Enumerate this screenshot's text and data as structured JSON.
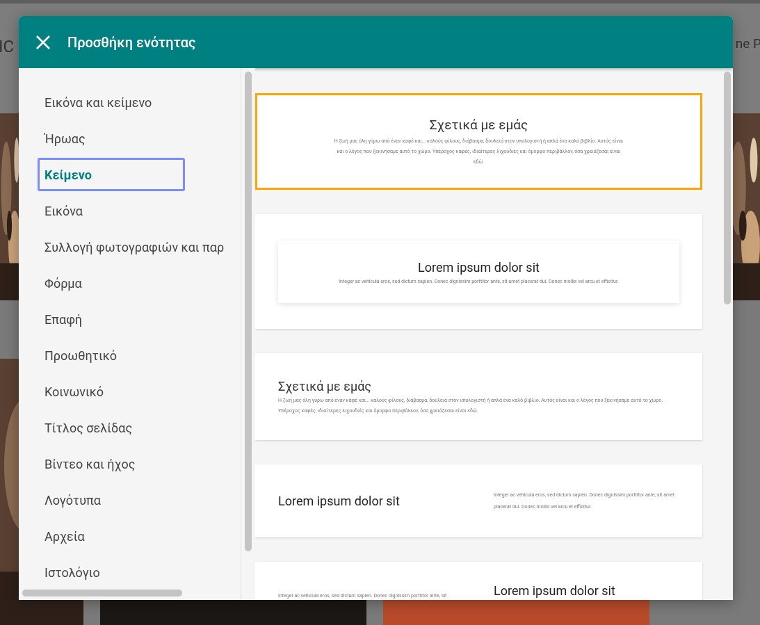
{
  "background": {
    "header_fragments": [
      "IC",
      "ne P"
    ]
  },
  "dialog": {
    "title": "Προσθήκη ενότητας"
  },
  "sidebar": {
    "items": [
      {
        "label": "Εικόνα και κείμενο",
        "selected": false
      },
      {
        "label": "Ήρωας",
        "selected": false
      },
      {
        "label": "Κείμενο",
        "selected": true
      },
      {
        "label": "Εικόνα",
        "selected": false
      },
      {
        "label": "Συλλογή φωτογραφιών και παρ",
        "selected": false
      },
      {
        "label": "Φόρμα",
        "selected": false
      },
      {
        "label": "Επαφή",
        "selected": false
      },
      {
        "label": "Προωθητικό",
        "selected": false
      },
      {
        "label": "Κοινωνικό",
        "selected": false
      },
      {
        "label": "Τίτλος σελίδας",
        "selected": false
      },
      {
        "label": "Βίντεο και ήχος",
        "selected": false
      },
      {
        "label": "Λογότυπα",
        "selected": false
      },
      {
        "label": "Αρχεία",
        "selected": false
      },
      {
        "label": "Ιστολόγιο",
        "selected": false
      }
    ]
  },
  "templates": [
    {
      "kind": "centered",
      "selected": true,
      "title": "Σχετικά με εμάς",
      "body": "Η ζωή μας όλη γύρω από έναν καφέ και... καλούς φίλους, διάβασμα, δουλειά στον υπολογιστή ή απλά ένα καλό βιβλίο. Αυτός είναι και ο λόγος που ξεκινήσαμε αυτό το χώρο. Υπέροχος καφές, ιδιαίτερες λιχουδιές και όμορφο περιβάλλον, όσα χρειάζεσαι είναι εδώ."
    },
    {
      "kind": "boxed",
      "selected": false,
      "title": "Lorem ipsum dolor sit",
      "body": "Integer ac vehicula eros, sed dictum sapien. Donec dignissim porttitor ante, sit amet placerat dui. Donec mollis vel arcu et efficitur."
    },
    {
      "kind": "left",
      "selected": false,
      "title": "Σχετικά με εμάς",
      "body": "Η ζωή μας όλη γύρω από έναν καφέ και... καλούς φίλους, διάβασμα, δουλειά στον υπολογιστή ή απλά ένα καλό βιβλίο. Αυτός είναι και ο λόγος που ξεκινήσαμε αυτό το χώρο. Υπέροχος καφές, ιδιαίτερες λιχουδιές και όμορφο περιβάλλον, όσα χρειάζεσαι είναι εδώ."
    },
    {
      "kind": "split",
      "selected": false,
      "title": "Lorem ipsum dolor sit",
      "body": "Integer ac vehicula eros, sed dictum sapien. Donec dignissim porttitor ante, sit amet placerat dui. Donec mollis vel arcu et efficitur."
    },
    {
      "kind": "split_reverse",
      "selected": false,
      "title": "Lorem ipsum dolor sit",
      "body": "Integer ac vehicula eros, sed dictum sapien. Donec dignissim porttitor ante, sit"
    }
  ]
}
